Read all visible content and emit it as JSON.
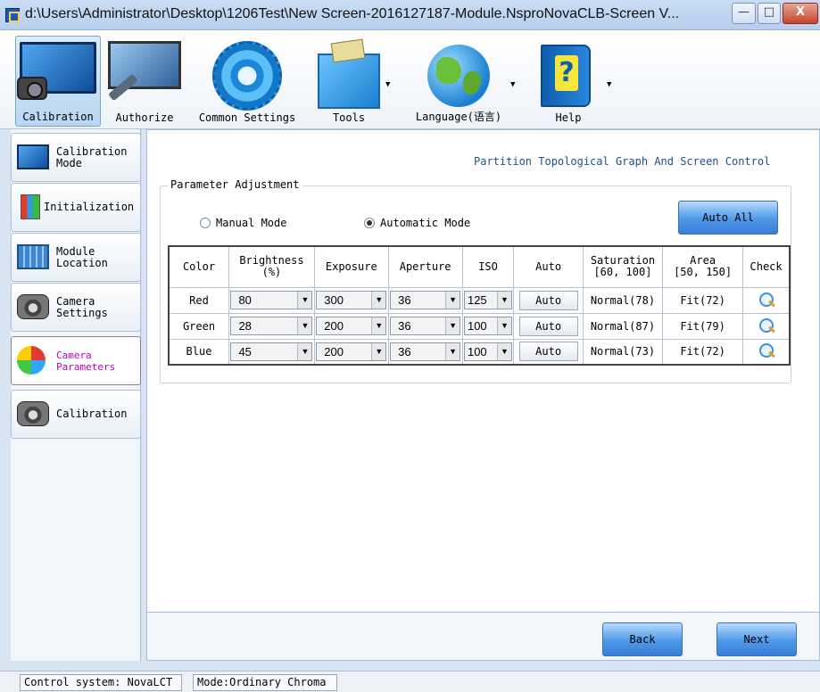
{
  "window": {
    "title": "d:\\Users\\Administrator\\Desktop\\1206Test\\New Screen-2016127187-Module.NsproNovaCLB-Screen V...",
    "app_icon": "novastar-app-icon",
    "controls": {
      "minimize": "—",
      "maximize": "□",
      "close": "X"
    }
  },
  "ribbon": {
    "buttons": [
      {
        "label": "Calibration",
        "icon": "monitor-camera-icon",
        "active": true
      },
      {
        "label": "Authorize",
        "icon": "monitor-wrench-icon"
      },
      {
        "label": "Common Settings",
        "icon": "gear-icon"
      },
      {
        "label": "Tools",
        "icon": "toolbox-icon",
        "has_dropdown": true
      },
      {
        "label": "Language(语言)",
        "icon": "globe-icon",
        "has_dropdown": true
      },
      {
        "label": "Help",
        "icon": "help-book-icon",
        "has_dropdown": true
      }
    ]
  },
  "sidebar": {
    "items": [
      {
        "label": "Calibration\nMode",
        "icon": "monitor-icon"
      },
      {
        "label": "Initialization",
        "icon": "battery-icon"
      },
      {
        "label": "Module\nLocation",
        "icon": "module-grid-icon"
      },
      {
        "label": "Camera\nSettings",
        "icon": "camera-icon"
      },
      {
        "label": "Camera\nParameters",
        "icon": "camera-color-icon",
        "active": true,
        "active_color": "#c000c0"
      },
      {
        "label": "Calibration",
        "icon": "camera-grid-icon"
      }
    ]
  },
  "main": {
    "topology_link": "Partition Topological Graph And Screen Control",
    "group_title": "Parameter Adjustment",
    "modes": {
      "manual": "Manual Mode",
      "automatic": "Automatic Mode",
      "selected": "automatic"
    },
    "auto_all": "Auto All",
    "table": {
      "headers": {
        "color": "Color",
        "brightness": "Brightness",
        "brightness_unit": "(%)",
        "exposure": "Exposure",
        "aperture": "Aperture",
        "iso": "ISO",
        "auto": "Auto",
        "saturation": "Saturation",
        "saturation_range": "[60, 100]",
        "area": "Area",
        "area_range": "[50, 150]",
        "check": "Check"
      },
      "rows": [
        {
          "color": "Red",
          "brightness": "80",
          "exposure": "300",
          "aperture": "36",
          "iso": "125",
          "auto": "Auto",
          "saturation": "Normal(78)",
          "area": "Fit(72)"
        },
        {
          "color": "Green",
          "brightness": "28",
          "exposure": "200",
          "aperture": "36",
          "iso": "100",
          "auto": "Auto",
          "saturation": "Normal(87)",
          "area": "Fit(79)"
        },
        {
          "color": "Blue",
          "brightness": "45",
          "exposure": "200",
          "aperture": "36",
          "iso": "100",
          "auto": "Auto",
          "saturation": "Normal(73)",
          "area": "Fit(72)"
        }
      ]
    },
    "back": "Back",
    "next": "Next"
  },
  "status": {
    "control_system": "Control system: NovaLCT",
    "mode": "Mode:Ordinary Chroma"
  },
  "colors": {
    "accent_button": "#4d98e8",
    "active_nav_text": "#c000c0",
    "link_text": "#1f4f86"
  }
}
